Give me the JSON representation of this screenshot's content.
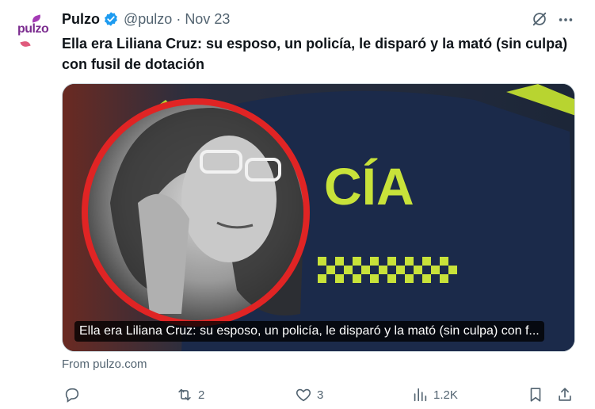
{
  "author": {
    "name": "Pulzo",
    "handle": "@pulzo",
    "separator": "·",
    "date": "Nov 23",
    "logo_text": "pulzo",
    "verified_color": "#1d9bf0"
  },
  "tweet": {
    "text": "Ella era Liliana Cruz: su esposo, un policía, le disparó y la mató (sin culpa) con fusil de dotación"
  },
  "card": {
    "title": "Ella era Liliana Cruz: su esposo, un policía, le disparó y la mató (sin culpa) con f...",
    "image_text": "CÍA",
    "source": "From pulzo.com"
  },
  "actions": {
    "replies": "",
    "retweets": "2",
    "likes": "3",
    "views": "1.2K"
  },
  "icons": [
    "verified-icon",
    "grok-icon",
    "more-icon",
    "reply-icon",
    "retweet-icon",
    "like-icon",
    "views-icon",
    "bookmark-icon",
    "share-icon"
  ],
  "colors": {
    "text": "#0f1419",
    "muted": "#536471",
    "accent": "#1d9bf0",
    "ring": "#e02424",
    "vest_text": "#c8e23a"
  }
}
